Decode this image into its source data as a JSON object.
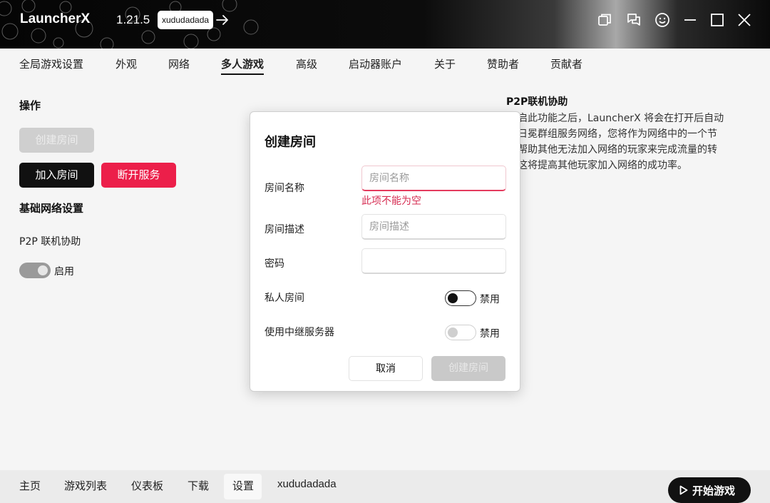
{
  "titlebar": {
    "app_name": "LauncherX",
    "version": "1.21.5",
    "user": "xududadada"
  },
  "tabs": [
    {
      "label": "全局游戏设置"
    },
    {
      "label": "外观"
    },
    {
      "label": "网络"
    },
    {
      "label": "多人游戏",
      "active": true
    },
    {
      "label": "高级"
    },
    {
      "label": "启动器账户"
    },
    {
      "label": "关于"
    },
    {
      "label": "赞助者"
    },
    {
      "label": "贡献者"
    }
  ],
  "left": {
    "ops_title": "操作",
    "create_room_btn": "创建房间",
    "join_room_btn": "加入房间",
    "disconnect_btn": "断开服务",
    "basic_net_title": "基础网络设置",
    "p2p_label": "P2P 联机协助",
    "p2p_toggle_label": "启用"
  },
  "right": {
    "title": "P2P联机协助",
    "lines": [
      "开启此功能之后，LauncherX 将会在打开后自动",
      "入日冕群组服务网络，您将作为网络中的一个节",
      "来帮助其他无法加入网络的玩家来完成流量的转",
      "，这将提高其他玩家加入网络的成功率。"
    ]
  },
  "modal": {
    "title": "创建房间",
    "room_name_label": "房间名称",
    "room_name_placeholder": "房间名称",
    "room_name_error": "此项不能为空",
    "room_desc_label": "房间描述",
    "room_desc_placeholder": "房间描述",
    "password_label": "密码",
    "private_label": "私人房间",
    "private_toggle_label": "禁用",
    "relay_label": "使用中继服务器",
    "relay_toggle_label": "禁用",
    "cancel_btn": "取消",
    "create_btn": "创建房间"
  },
  "bottomnav": {
    "items": [
      {
        "label": "主页"
      },
      {
        "label": "游戏列表"
      },
      {
        "label": "仪表板"
      },
      {
        "label": "下载"
      },
      {
        "label": "设置",
        "active": true
      },
      {
        "label": "xududadada"
      }
    ],
    "start_btn": "开始游戏"
  },
  "colors": {
    "accent_red": "#ec1f4a",
    "error_red": "#d62c52",
    "dark": "#111111"
  },
  "icons": [
    "arrow-right-icon",
    "window-icon",
    "chat-icon",
    "smile-icon",
    "minimize-icon",
    "maximize-icon",
    "close-icon",
    "play-icon"
  ]
}
